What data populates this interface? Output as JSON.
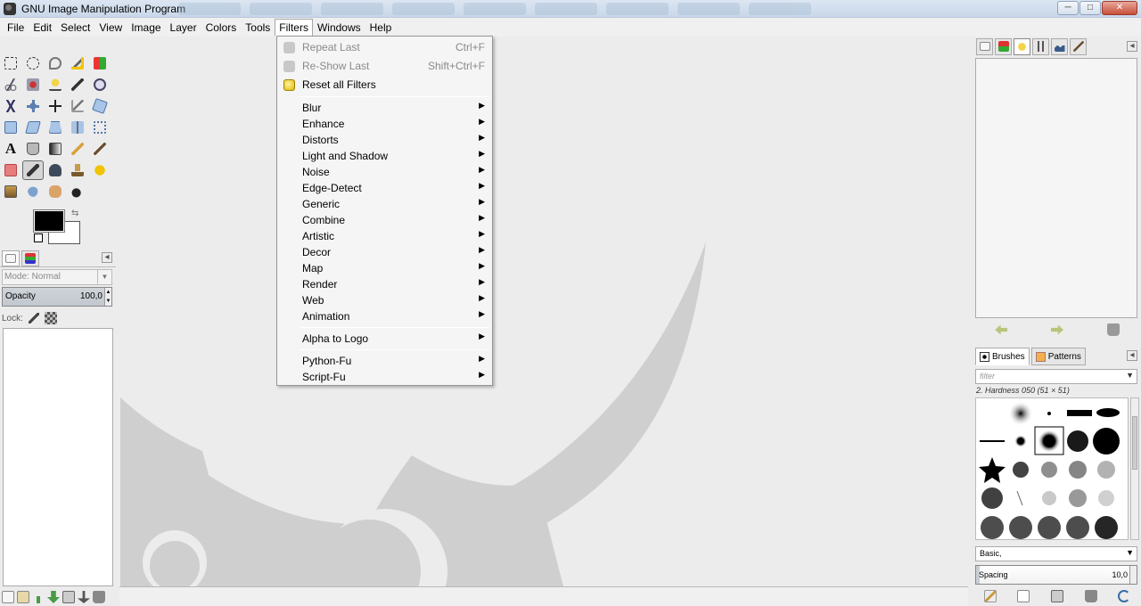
{
  "window": {
    "title": "GNU Image Manipulation Program",
    "buttons": {
      "minimize": "─",
      "maximize": "□",
      "close": "✕"
    }
  },
  "menubar": {
    "items": [
      "File",
      "Edit",
      "Select",
      "View",
      "Image",
      "Layer",
      "Colors",
      "Tools",
      "Filters",
      "Windows",
      "Help"
    ],
    "active": "Filters"
  },
  "filters_menu": {
    "items": [
      {
        "label": "Repeat Last",
        "shortcut": "Ctrl+F",
        "disabled": true,
        "icon": "repeat-icon"
      },
      {
        "label": "Re-Show Last",
        "shortcut": "Shift+Ctrl+F",
        "disabled": true,
        "icon": "reshow-icon"
      },
      {
        "label": "Reset all Filters",
        "shortcut": "",
        "disabled": false,
        "icon": "reset-icon"
      },
      {
        "label": "Blur",
        "submenu": true
      },
      {
        "label": "Enhance",
        "submenu": true
      },
      {
        "label": "Distorts",
        "submenu": true
      },
      {
        "label": "Light and Shadow",
        "submenu": true
      },
      {
        "label": "Noise",
        "submenu": true
      },
      {
        "label": "Edge-Detect",
        "submenu": true
      },
      {
        "label": "Generic",
        "submenu": true
      },
      {
        "label": "Combine",
        "submenu": true
      },
      {
        "label": "Artistic",
        "submenu": true
      },
      {
        "label": "Decor",
        "submenu": true
      },
      {
        "label": "Map",
        "submenu": true
      },
      {
        "label": "Render",
        "submenu": true
      },
      {
        "label": "Web",
        "submenu": true
      },
      {
        "label": "Animation",
        "submenu": true
      },
      {
        "label": "Alpha to Logo",
        "submenu": true
      },
      {
        "label": "Python-Fu",
        "submenu": true
      },
      {
        "label": "Script-Fu",
        "submenu": true
      }
    ],
    "submenu_arrow": "▶"
  },
  "layers_dock": {
    "mode_label": "Mode: Normal",
    "opacity_label": "Opacity",
    "opacity_value": "100,0",
    "lock_label": "Lock:"
  },
  "brushes_dock": {
    "tab_brushes": "Brushes",
    "tab_patterns": "Patterns",
    "filter_placeholder": "filter",
    "brush_name": "2. Hardness 050 (51 × 51)",
    "preset": "Basic,",
    "spacing_label": "Spacing",
    "spacing_value": "10,0"
  },
  "colors": {
    "foreground": "#000000",
    "background": "#ffffff",
    "menu_bg": "#f5f5f5",
    "canvas_bg": "#ececec",
    "wilber": "#cfcfcf"
  }
}
